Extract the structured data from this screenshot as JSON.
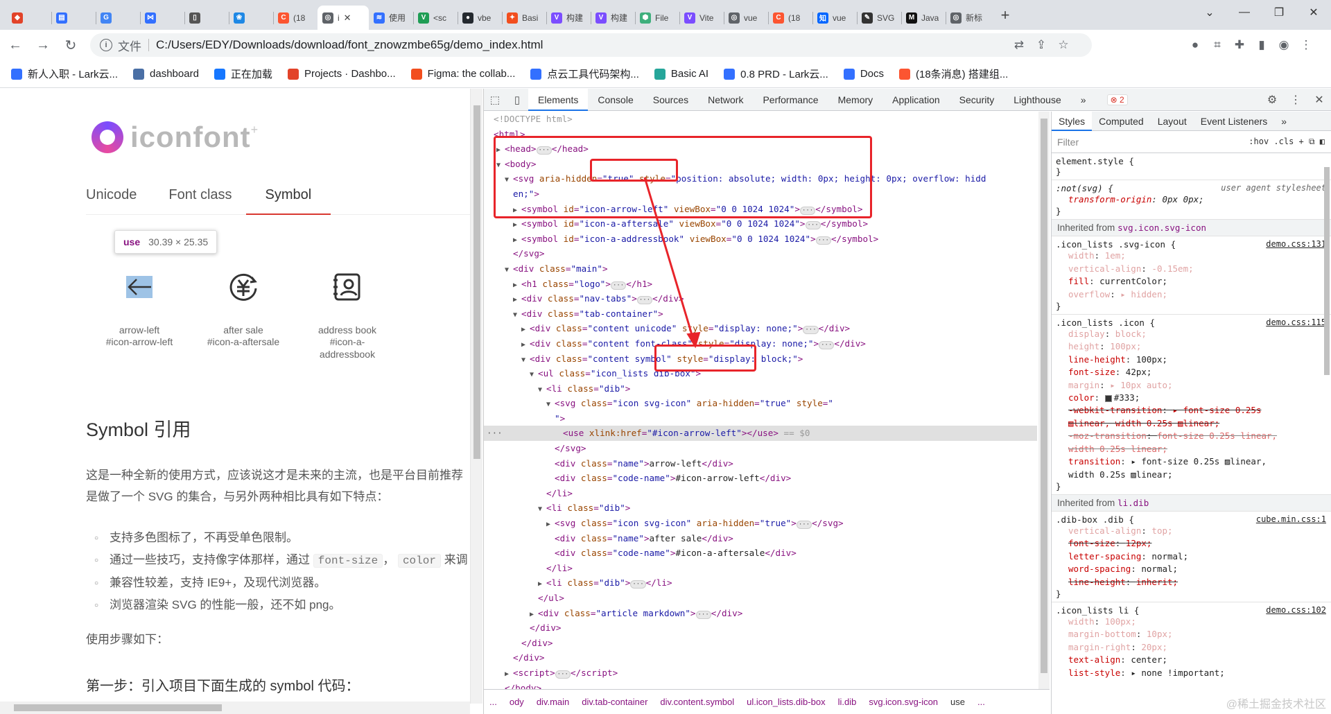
{
  "browser": {
    "tabs": [
      {
        "label": "",
        "color": "#e24329",
        "glyph": "◆"
      },
      {
        "label": "",
        "color": "#3370ff",
        "glyph": "▤"
      },
      {
        "label": "",
        "color": "#4285f4",
        "glyph": "G"
      },
      {
        "label": "",
        "color": "#3370ff",
        "glyph": "⋈"
      },
      {
        "label": "",
        "color": "#555555",
        "glyph": "▯"
      },
      {
        "label": "",
        "color": "#1e88e5",
        "glyph": "❀"
      },
      {
        "label": "(18",
        "color": "#fc5531",
        "glyph": "C"
      },
      {
        "label": "i",
        "color": "#5f6368",
        "glyph": "◎",
        "active": true
      },
      {
        "label": "使用",
        "color": "#3370ff",
        "glyph": "≋"
      },
      {
        "label": "<sc",
        "color": "#1f9d55",
        "glyph": "V"
      },
      {
        "label": "vbe",
        "color": "#24292f",
        "glyph": "●"
      },
      {
        "label": "Basi",
        "color": "#f24e1e",
        "glyph": "✦"
      },
      {
        "label": "构建",
        "color": "#7b4dff",
        "glyph": "V"
      },
      {
        "label": "构建",
        "color": "#7b4dff",
        "glyph": "V"
      },
      {
        "label": "File",
        "color": "#3eaf7c",
        "glyph": "⬢"
      },
      {
        "label": "Vite",
        "color": "#7b4dff",
        "glyph": "V"
      },
      {
        "label": "vue",
        "color": "#5f6368",
        "glyph": "◎"
      },
      {
        "label": "(18",
        "color": "#fc5531",
        "glyph": "C"
      },
      {
        "label": "vue",
        "color": "#0066ff",
        "glyph": "知"
      },
      {
        "label": "SVG",
        "color": "#333333",
        "glyph": "✎"
      },
      {
        "label": "Java",
        "color": "#111111",
        "glyph": "M"
      },
      {
        "label": "新标",
        "color": "#5f6368",
        "glyph": "◎"
      }
    ],
    "active_tab_close": "✕",
    "new_tab": "+",
    "window_controls": [
      "⌄",
      "—",
      "❐",
      "✕"
    ],
    "nav": {
      "back": "←",
      "forward": "→",
      "reload": "↻"
    },
    "omnibox": {
      "info_icon": "i",
      "file_label": "文件",
      "url": "C:/Users/EDY/Downloads/download/font_znowzmbe65g/demo_index.html"
    },
    "omni_icons": [
      "⇄",
      "⇪",
      "☆"
    ],
    "ext_icons": [
      "●",
      "⌗",
      "✚",
      "▮",
      "◉",
      "⋮"
    ],
    "bookmarks": [
      {
        "label": "新人入职 - Lark云...",
        "color": "#3370ff"
      },
      {
        "label": "dashboard",
        "color": "#4a6fa5"
      },
      {
        "label": "正在加载",
        "color": "#1677ff"
      },
      {
        "label": "Projects · Dashbo...",
        "color": "#e24329"
      },
      {
        "label": "Figma: the collab...",
        "color": "#f24e1e"
      },
      {
        "label": "点云工具代码架构...",
        "color": "#3370ff"
      },
      {
        "label": "Basic AI",
        "color": "#26a69a"
      },
      {
        "label": "0.8 PRD - Lark云...",
        "color": "#3370ff"
      },
      {
        "label": "Docs",
        "color": "#3370ff"
      },
      {
        "label": "(18条消息) 搭建组...",
        "color": "#fc5531"
      }
    ]
  },
  "page": {
    "logo_text": "iconfont",
    "logo_plus": "+",
    "nav_tabs": [
      "Unicode",
      "Font class",
      "Symbol"
    ],
    "tooltip": {
      "tag": "use",
      "size": "30.39 × 25.35"
    },
    "icons": [
      {
        "name": "arrow-left",
        "code": "#icon-arrow-left"
      },
      {
        "name": "after sale",
        "code": "#icon-a-aftersale"
      },
      {
        "name": "address book",
        "code": "#icon-a-",
        "code2": "addressbook"
      }
    ],
    "section_title": "Symbol 引用",
    "para_line1": "这是一种全新的使用方式，应该说这才是未来的主流，也是平台目前推荐",
    "para_line2": "是做了一个 SVG 的集合，与另外两种相比具有如下特点：",
    "bullets": {
      "b1": "支持多色图标了，不再受单色限制。",
      "b2_pre": "通过一些技巧，支持像字体那样，通过",
      "b2_code1": "font-size",
      "b2_comma": "，",
      "b2_code2": "color",
      "b2_post": "来调",
      "b3": "兼容性较差，支持 IE9+，及现代浏览器。",
      "b4": "浏览器渲染 SVG 的性能一般，还不如 png。"
    },
    "steps_label": "使用步骤如下：",
    "step1": "第一步：引入项目下面生成的 symbol 代码："
  },
  "devtools": {
    "tabs": [
      "Elements",
      "Console",
      "Sources",
      "Network",
      "Performance",
      "Memory",
      "Application",
      "Security",
      "Lighthouse"
    ],
    "more_tabs": "»",
    "error_count": "⊗ 2",
    "right_icons": [
      "⚙",
      "⋮",
      "✕"
    ],
    "dom": {
      "l1": "<!DOCTYPE html>",
      "l2": "<html>",
      "l3_open": "<head>",
      "l3_close": "</head>",
      "l4": "<body>",
      "svg_open_pre": "<svg ",
      "svg_attr1": "aria-hidden",
      "svg_val1": "\"true\"",
      "svg_attr2": "style",
      "svg_val2": "\"position: absolute; width: 0px; height: 0px; overflow: hidd",
      "svg_val2b": "en;\"",
      "sym1": "\"icon-arrow-left\"",
      "sym2": "\"icon-a-aftersale\"",
      "sym3": "\"icon-a-addressbook\"",
      "viewbox": "\"0 0 1024 1024\"",
      "svg_close": "</svg>",
      "main_class": "\"main\"",
      "logo_class": "\"logo\"",
      "navtabs_class": "\"nav-tabs\"",
      "tabcontainer_class": "\"tab-container\"",
      "content_unicode": "\"content unicode\"",
      "content_fontclass": "\"content font-class\"",
      "content_symbol": "\"content symbol\"",
      "display_none": "\"display: none;\"",
      "display_block": "\"display: block;\"",
      "ul_class": "\"icon_lists dib-box\"",
      "li_class": "\"dib\"",
      "svgicon_class": "\"icon svg-icon\"",
      "use_href": "\"#icon-arrow-left\"",
      "selected_marker": "== $0",
      "name_arrow": "arrow-left",
      "code_arrow": "#icon-arrow-left",
      "name_after": "after sale",
      "code_after": "#icon-a-aftersale",
      "article_class": "\"article markdown\""
    },
    "breadcrumbs": [
      "...",
      "ody",
      "div.main",
      "div.tab-container",
      "div.content.symbol",
      "ul.icon_lists.dib-box",
      "li.dib",
      "svg.icon.svg-icon",
      "use",
      "..."
    ],
    "styles": {
      "tabs": [
        "Styles",
        "Computed",
        "Layout",
        "Event Listeners",
        "»"
      ],
      "filter_placeholder": "Filter",
      "filter_tools": ":hov  .cls  +  ⧉  ◧",
      "element_style": "element.style {",
      "close_brace": "}",
      "ua_rule": ":not(svg) {",
      "ua_label": "user agent stylesheet",
      "ua_decl_p": "transform-origin",
      "ua_decl_v": "0px 0px;",
      "inherited1_label": "Inherited from",
      "inherited1_sel": "svg.icon.svg-icon",
      "r1_sel": ".icon_lists .svg-icon {",
      "r1_src": "demo.css:131",
      "r1_decls": [
        {
          "p": "width",
          "v": "1em;",
          "faded": true
        },
        {
          "p": "vertical-align",
          "v": "-0.15em;",
          "faded": true
        },
        {
          "p": "fill",
          "v": "currentColor;",
          "faded": false
        },
        {
          "p": "overflow",
          "v": "▸ hidden;",
          "faded": true
        }
      ],
      "r2_sel": ".icon_lists .icon {",
      "r2_src": "demo.css:115",
      "r2_decls": [
        {
          "p": "display",
          "v": "block;",
          "faded": true
        },
        {
          "p": "height",
          "v": "100px;",
          "faded": true
        },
        {
          "p": "line-height",
          "v": "100px;",
          "faded": false
        },
        {
          "p": "font-size",
          "v": "42px;",
          "faded": false
        },
        {
          "p": "margin",
          "v": "▸ 10px auto;",
          "faded": true
        },
        {
          "p": "color",
          "v": "#333;",
          "faded": false,
          "swatch": "#333333"
        },
        {
          "p": "-webkit-transition",
          "v": "▸ font-size 0.25s",
          "strike": true
        },
        {
          "p": "",
          "v": "  ▨linear, width 0.25s ▨linear;",
          "strike": true
        },
        {
          "p": "-moz-transition",
          "v": "font-size 0.25s linear,",
          "strike": true,
          "faded": true
        },
        {
          "p": "",
          "v": "  width 0.25s linear;",
          "strike": true,
          "faded": true
        },
        {
          "p": "transition",
          "v": "▸ font-size 0.25s ▨linear,",
          "faded": false
        },
        {
          "p": "",
          "v": "  width 0.25s ▨linear;",
          "faded": false
        }
      ],
      "inherited2_label": "Inherited from",
      "inherited2_sel": "li.dib",
      "r3_sel": ".dib-box .dib {",
      "r3_src": "cube.min.css:1",
      "r3_decls": [
        {
          "p": "vertical-align",
          "v": "top;",
          "faded": true
        },
        {
          "p": "font-size",
          "v": "12px;",
          "strike": true
        },
        {
          "p": "letter-spacing",
          "v": "normal;",
          "faded": false
        },
        {
          "p": "word-spacing",
          "v": "normal;",
          "faded": false
        },
        {
          "p": "line-height",
          "v": "inherit;",
          "strike": true
        }
      ],
      "r4_sel": ".icon_lists li {",
      "r4_src": "demo.css:102",
      "r4_decls": [
        {
          "p": "width",
          "v": "100px;",
          "faded": true
        },
        {
          "p": "margin-bottom",
          "v": "10px;",
          "faded": true
        },
        {
          "p": "margin-right",
          "v": "20px;",
          "faded": true
        },
        {
          "p": "text-align",
          "v": "center;",
          "faded": false
        },
        {
          "p": "list-style",
          "v": "▸ none !important;",
          "faded": false
        }
      ]
    }
  },
  "watermark": "@稀土掘金技术社区",
  "colors": {
    "annotation_red": "#e8242a",
    "accent_blue": "#1a73e8",
    "tab_red": "#d83830"
  }
}
